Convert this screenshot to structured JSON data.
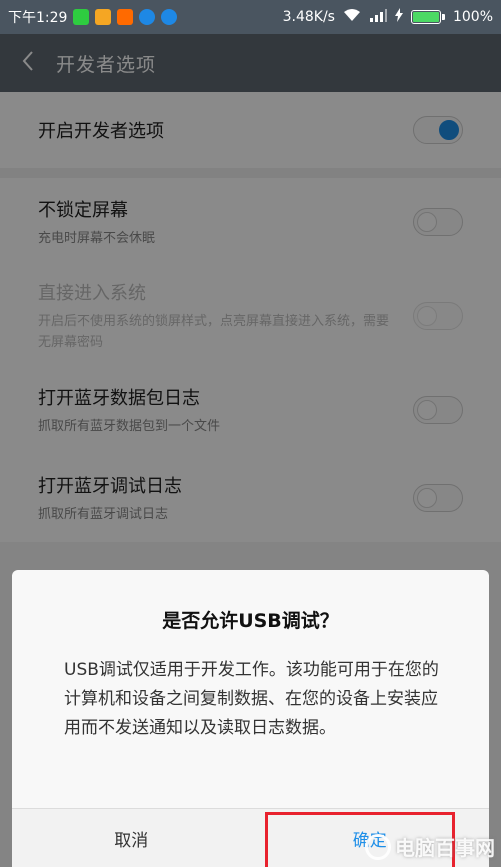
{
  "status_bar": {
    "time": "下午1:29",
    "network_speed": "3.48K/s",
    "battery": "100%",
    "battery_level": 1.0,
    "app_icons": [
      {
        "name": "green-app-icon",
        "color": "#2ecc40"
      },
      {
        "name": "message-app-icon",
        "color": "#f5a623"
      },
      {
        "name": "orange-app-icon",
        "color": "#ff6a00"
      },
      {
        "name": "blue-app-icon",
        "color": "#1e88e5"
      },
      {
        "name": "browser-app-icon",
        "color": "#1e88e5"
      }
    ]
  },
  "title_bar": {
    "back_icon": "chevron-left-icon",
    "title": "开发者选项"
  },
  "settings": {
    "developer_options": {
      "title": "开启开发者选项",
      "enabled": true
    },
    "rows": [
      {
        "title": "不锁定屏幕",
        "subtitle": "充电时屏幕不会休眠",
        "enabled": false,
        "disabled": false
      },
      {
        "title": "直接进入系统",
        "subtitle": "开启后不使用系统的锁屏样式，点亮屏幕直接进入系统，需要无屏幕密码",
        "enabled": false,
        "disabled": true
      },
      {
        "title": "打开蓝牙数据包日志",
        "subtitle": "抓取所有蓝牙数据包到一个文件",
        "enabled": false,
        "disabled": false
      },
      {
        "title": "打开蓝牙调试日志",
        "subtitle": "抓取所有蓝牙调试日志",
        "enabled": false,
        "disabled": false
      }
    ]
  },
  "dialog": {
    "title": "是否允许USB调试？",
    "message": "USB调试仅适用于开发工作。该功能可用于在您的计算机和设备之间复制数据、在您的设备上安装应用而不发送通知以及读取日志数据。",
    "cancel_label": "取消",
    "confirm_label": "确定"
  },
  "watermark": {
    "text": "电脑百事网"
  },
  "colors": {
    "accent": "#1e8fe8",
    "highlight": "#e8222e"
  }
}
